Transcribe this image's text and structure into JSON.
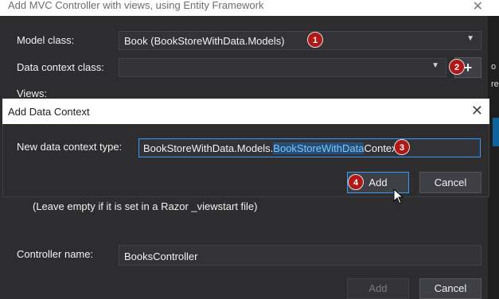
{
  "outer": {
    "title": "Add MVC Controller with views, using Entity Framework",
    "model_class_label": "Model class:",
    "model_class_value": "Book (BookStoreWithData.Models)",
    "data_context_label": "Data context class:",
    "data_context_value": "",
    "views_label": "Views:",
    "layout_hint": "(Leave empty if it is set in a Razor _viewstart file)",
    "controller_name_label": "Controller name:",
    "controller_name_value": "BooksController",
    "add_label": "Add",
    "cancel_label": "Cancel",
    "plus_label": "+"
  },
  "modal": {
    "title": "Add Data Context",
    "type_label": "New data context type:",
    "type_prefix": "BookStoreWithData.Models.",
    "type_selected": "BookStoreWithData",
    "type_suffix": "Context",
    "add_label": "Add",
    "cancel_label": "Cancel"
  },
  "badges": [
    "1",
    "2",
    "3",
    "4"
  ],
  "edge": {
    "t1": "o",
    "t2": "re"
  },
  "colors": {
    "accent": "#3399ff",
    "badge": "#b01818",
    "background": "#2d2d30"
  }
}
